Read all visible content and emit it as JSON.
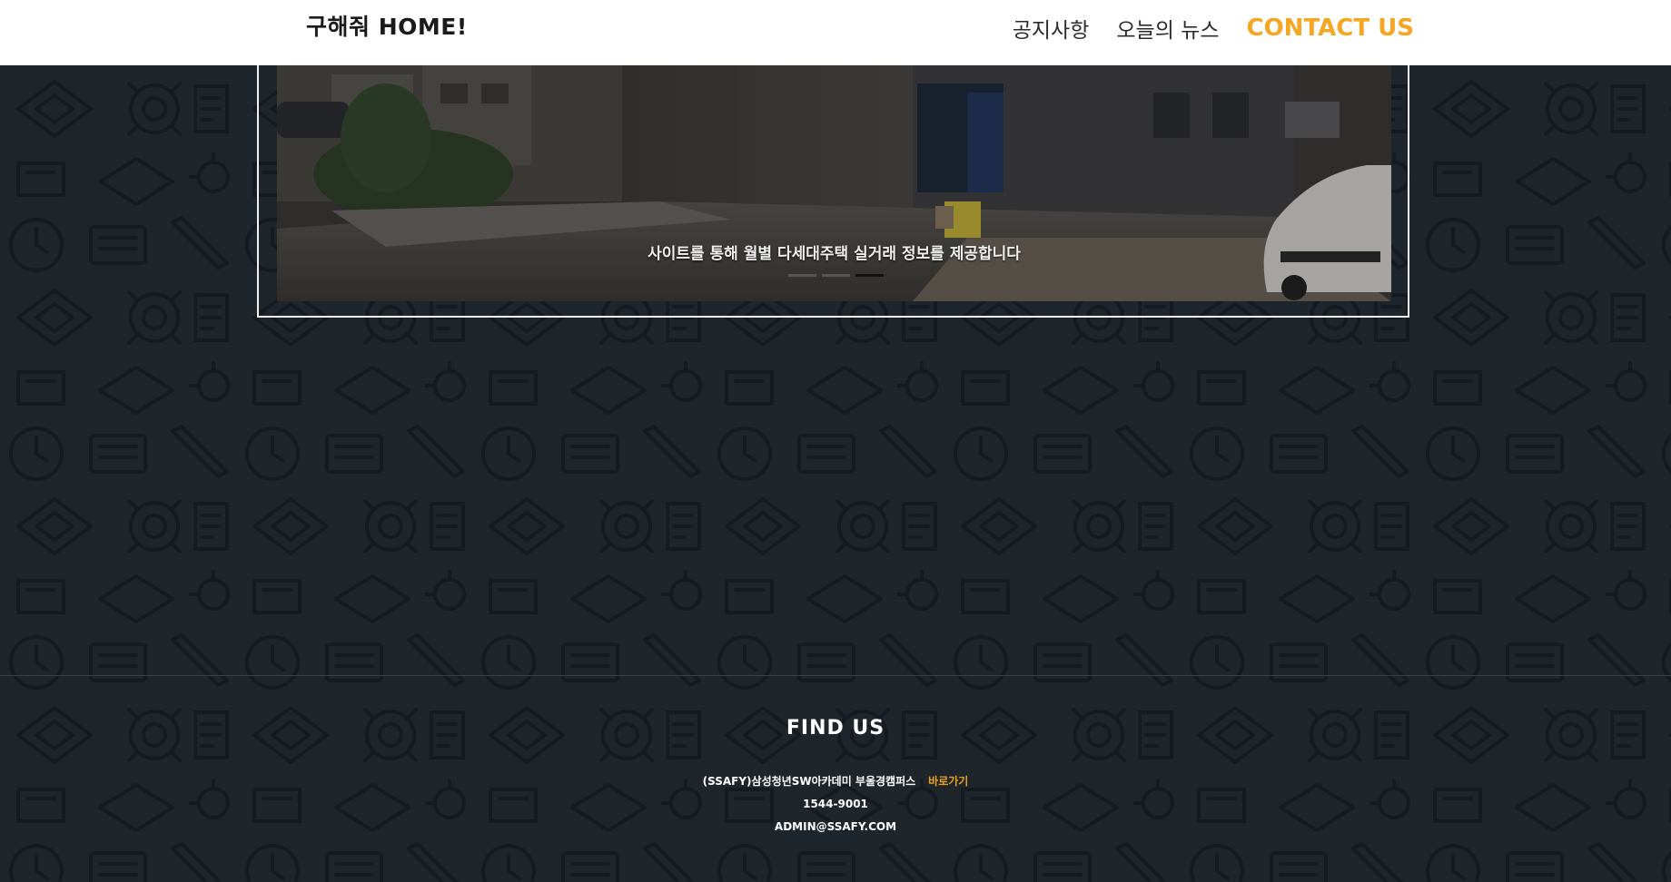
{
  "colors": {
    "accent": "#f5a623",
    "background": "#1e252b",
    "header_bg": "#ffffff",
    "pattern": "#161c21"
  },
  "header": {
    "brand": "구해줘 HOME!",
    "nav": [
      {
        "label": "공지사항"
      },
      {
        "label": "오늘의 뉴스"
      },
      {
        "label": "CONTACT US"
      }
    ]
  },
  "carousel": {
    "caption": "사이트를 통해 월별 다세대주택 실거래 정보를 제공합니다",
    "slide_count": 3,
    "active_index": 2
  },
  "footer": {
    "title": "FIND US",
    "address": "(SSAFY)삼성청년SW아카데미 부울경캠퍼스",
    "link_label": "바로가기",
    "phone": "1544-9001",
    "email": "ADMIN@SSAFY.COM"
  }
}
